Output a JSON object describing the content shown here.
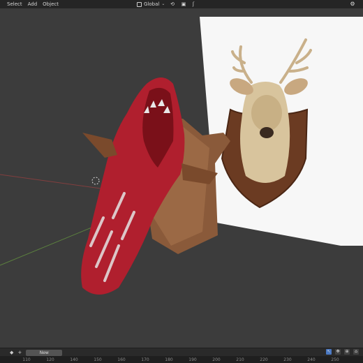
{
  "header": {
    "menu": [
      "Select",
      "Add",
      "Object"
    ],
    "orientation": "Global"
  },
  "icons": {
    "orientation": "transform-orientation-icon",
    "pivot": "pivot-point-icon",
    "snap": "snap-icon",
    "viewport_right": "viewport-shading-icon"
  },
  "viewport": {
    "objects": [
      "crocodile-head-mount",
      "wooden-plaque",
      "deer-trophy-reference-image"
    ],
    "colors": {
      "background": "#3c3c3c",
      "axis_x": "#a04040",
      "axis_y": "#6aa040"
    }
  },
  "timeline": {
    "new_label": "New",
    "frame_ticks": [
      "110",
      "120",
      "140",
      "150",
      "160",
      "170",
      "180",
      "190",
      "200",
      "210",
      "220",
      "230",
      "240",
      "250"
    ]
  }
}
